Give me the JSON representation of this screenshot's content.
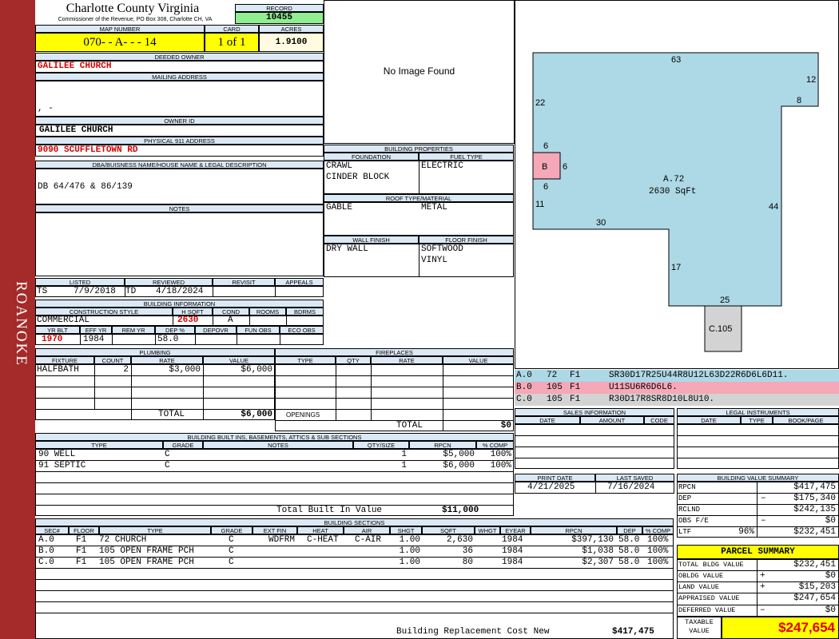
{
  "side_label": "ROANOKE",
  "header": {
    "county": "Charlotte County Virginia",
    "commissioner": "Commissioner of the Revenue, PO Box 308, Charlotte CH, VA",
    "record_label": "RECORD",
    "record": "10455",
    "map_number_label": "MAP NUMBER",
    "map_number": "070- - A- - - 14",
    "card_label": "CARD",
    "card": "1 of 1",
    "acres_label": "ACRES",
    "acres": "1.9100"
  },
  "owner": {
    "deeded_owner_label": "DEEDED OWNER",
    "deeded_owner": "GALILEE CHURCH",
    "mailing_address_label": "MAILING ADDRESS",
    "mailing_address": ", -",
    "owner_id_label": "OWNER ID",
    "owner_id": "GALILEE CHURCH",
    "physical_address_label": "PHYSICAL 911 ADDRESS",
    "physical_address": "9090 SCUFFLETOWN RD",
    "dba_label": "DBA/BUISNESS NAME/HOUSE NAME & LEGAL DESCRIPTION",
    "dba": "DB 64/476 & 86/139",
    "notes_label": "NOTES",
    "notes": ""
  },
  "image_placeholder": "No Image Found",
  "listed": {
    "listed_label": "LISTED",
    "listed_by": "TS",
    "listed_date": "7/9/2018",
    "reviewed_label": "REVIEWED",
    "reviewed_by": "TD",
    "reviewed_date": "4/18/2024",
    "revisit_label": "REVISIT",
    "appeals_label": "APPEALS"
  },
  "building_info": {
    "label": "BUILDING INFORMATION",
    "construction_style_label": "CONSTRUCTION STYLE",
    "construction_style": "COMMERCIAL",
    "hsqft_label": "H SQFT",
    "hsqft": "2630",
    "cond_label": "COND",
    "cond": "A",
    "rooms_label": "ROOMS",
    "bdrms_label": "BDRMS",
    "yr_blt_label": "YR BLT",
    "yr_blt": "1970",
    "eff_yr_label": "EFF YR",
    "eff_yr": "1984",
    "rem_yr_label": "REM YR",
    "dep_label": "DEP %",
    "dep": "58.0",
    "depovr_label": "DEPOVR",
    "fun_obs_label": "FUN OBS",
    "eco_obs_label": "ECO OBS"
  },
  "building_properties": {
    "label": "BUILDING PROPERTIES",
    "foundation_label": "FOUNDATION",
    "foundation": [
      "CRAWL",
      "CINDER BLOCK"
    ],
    "fuel_label": "FUEL TYPE",
    "fuel": "ELECTRIC",
    "roof_label": "ROOF TYPE/MATERIAL",
    "roof_type": "GABLE",
    "roof_material": "METAL",
    "wall_label": "WALL FINISH",
    "wall": "DRY WALL",
    "floor_label": "FLOOR FINISH",
    "floor": [
      "SOFTWOOD",
      "VINYL"
    ]
  },
  "plumbing": {
    "label": "PLUMBING",
    "headers": [
      "FIXTURE",
      "COUNT",
      "RATE",
      "VALUE"
    ],
    "rows": [
      {
        "fixture": "HALFBATH",
        "count": "2",
        "rate": "$3,000",
        "value": "$6,000"
      }
    ],
    "total_label": "TOTAL",
    "total": "$6,000"
  },
  "fireplaces": {
    "label": "FIREPLACES",
    "headers": [
      "TYPE",
      "QTY",
      "RATE",
      "VALUE"
    ],
    "openings_label": "OPENINGS",
    "total_label": "TOTAL",
    "total": "$0"
  },
  "sketch": {
    "labels": [
      "63",
      "12",
      "8",
      "22",
      "6",
      "6",
      "6",
      "11",
      "30",
      "44",
      "17",
      "25"
    ],
    "area_a": "A.72",
    "area_a_sqft": "2630 SqFt",
    "area_b": "B",
    "area_c": "C.105",
    "colors": {
      "main": "#add8e6",
      "porch_b": "#f4a8b8",
      "porch_c": "#d3d3d3"
    }
  },
  "sketch_codes": [
    {
      "code": "A.0",
      "area": "72",
      "floor": "F1",
      "path": "SR30D17R25U44R8U12L63D22R6D6L6D11."
    },
    {
      "code": "B.0",
      "area": "105",
      "floor": "F1",
      "path": "U11SU6R6D6L6."
    },
    {
      "code": "C.0",
      "area": "105",
      "floor": "F1",
      "path": "R30D17R8SR8D10L8U10."
    }
  ],
  "sales": {
    "label": "SALES INFORMATION",
    "headers": [
      "DATE",
      "AMOUNT",
      "CODE"
    ]
  },
  "legal": {
    "label": "LEGAL INSTRUMENTS",
    "headers": [
      "DATE",
      "TYPE",
      "BOOK/PAGE"
    ]
  },
  "built_ins": {
    "label": "BUILDING BUILT INS, BASEMENTS, ATTICS & SUB SECTIONS",
    "headers": [
      "TYPE",
      "GRADE",
      "NOTES",
      "QTY/SIZE",
      "RPCN",
      "% COMP"
    ],
    "rows": [
      {
        "type": "90 WELL",
        "grade": "C",
        "notes": "",
        "qty": "1",
        "rpcn": "$5,000",
        "comp": "100%"
      },
      {
        "type": "91 SEPTIC",
        "grade": "C",
        "notes": "",
        "qty": "1",
        "rpcn": "$6,000",
        "comp": "100%"
      }
    ],
    "total_label": "Total Built In Value",
    "total": "$11,000"
  },
  "print": {
    "print_date_label": "PRINT DATE",
    "print_date": "4/21/2025",
    "last_saved_label": "LAST SAVED",
    "last_saved": "7/16/2024"
  },
  "value_summary": {
    "label": "BUILDING VALUE SUMMARY",
    "rows": [
      {
        "label": "RPCN",
        "sign": "",
        "value": "$417,475"
      },
      {
        "label": "DEP",
        "sign": "–",
        "value": "$175,340"
      },
      {
        "label": "RCLND",
        "sign": "",
        "value": "$242,135"
      },
      {
        "label": "OBS F/E",
        "sign": "–",
        "value": "$0"
      },
      {
        "label": "LTF",
        "pct": "96%",
        "sign": "",
        "value": "$232,451"
      }
    ]
  },
  "sections": {
    "label": "BUILDING SECTIONS",
    "headers": [
      "SEC#",
      "FLOOR",
      "TYPE",
      "GRADE",
      "EXT FIN",
      "HEAT",
      "AIR",
      "SHGT",
      "SQFT",
      "WHGT",
      "EYEAR",
      "RPCN",
      "DEP",
      "% COMP"
    ],
    "rows": [
      {
        "sec": "A.0",
        "floor": "F1",
        "type": "72 CHURCH",
        "grade": "C",
        "ext": "WDFRM",
        "heat": "C-HEAT",
        "air": "C-AIR",
        "shgt": "1.00",
        "sqft": "2,630",
        "whgt": "",
        "eyear": "1984",
        "rpcn": "$397,130",
        "dep": "58.0",
        "comp": "100%"
      },
      {
        "sec": "B.0",
        "floor": "F1",
        "type": "105 OPEN FRAME PCH",
        "grade": "C",
        "ext": "",
        "heat": "",
        "air": "",
        "shgt": "1.00",
        "sqft": "36",
        "whgt": "",
        "eyear": "1984",
        "rpcn": "$1,038",
        "dep": "58.0",
        "comp": "100%"
      },
      {
        "sec": "C.0",
        "floor": "F1",
        "type": "105 OPEN FRAME PCH",
        "grade": "C",
        "ext": "",
        "heat": "",
        "air": "",
        "shgt": "1.00",
        "sqft": "80",
        "whgt": "",
        "eyear": "1984",
        "rpcn": "$2,307",
        "dep": "58.0",
        "comp": "100%"
      }
    ],
    "total_label": "Building Replacement Cost New",
    "total": "$417,475"
  },
  "parcel_summary": {
    "label": "PARCEL SUMMARY",
    "rows": [
      {
        "label": "TOTAL BLDG VALUE",
        "sign": "",
        "value": "$232,451"
      },
      {
        "label": "OBLDG VALUE",
        "sign": "+",
        "value": "$0"
      },
      {
        "label": "LAND VALUE",
        "sign": "+",
        "value": "$15,203"
      },
      {
        "label": "APPRAISED VALUE",
        "sign": "",
        "value": "$247,654"
      },
      {
        "label": "DEFERRED VALUE",
        "sign": "–",
        "value": "$0"
      }
    ],
    "taxable_label": "TAXABLE VALUE",
    "taxable": "$247,654"
  }
}
